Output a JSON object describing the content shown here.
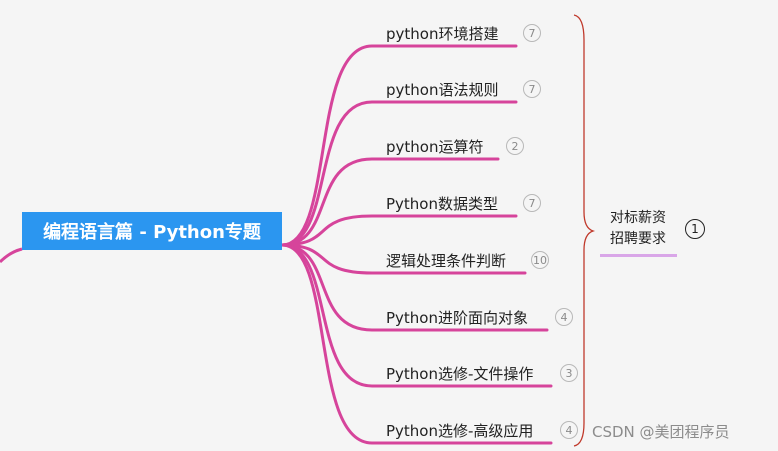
{
  "root": {
    "label": "编程语言篇 - Python专题"
  },
  "branches": [
    {
      "label": "python环境搭建",
      "count": "7"
    },
    {
      "label": "python语法规则",
      "count": "7"
    },
    {
      "label": "python运算符",
      "count": "2"
    },
    {
      "label": "Python数据类型",
      "count": "7"
    },
    {
      "label": "逻辑处理条件判断",
      "count": "10"
    },
    {
      "label": "Python进阶面向对象",
      "count": "4"
    },
    {
      "label": "Python选修-文件操作",
      "count": "3"
    },
    {
      "label": "Python选修-高级应用",
      "count": "4"
    }
  ],
  "summary": {
    "line1": "对标薪资",
    "line2": "招聘要求",
    "count": "1"
  },
  "watermark": "CSDN @美团程序员",
  "colors": {
    "root_bg": "#2b96f0",
    "branch_line": "#d6449b",
    "summary_underline": "#d9a6e8"
  }
}
